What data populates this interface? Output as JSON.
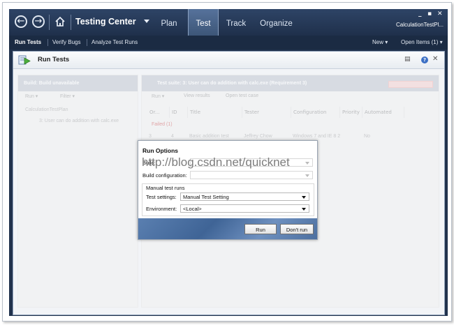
{
  "app": {
    "title": "Testing Center",
    "back_icon": "back-arrow-icon",
    "forward_icon": "forward-arrow-icon",
    "home_icon": "home-icon",
    "tabs": [
      {
        "label": "Plan"
      },
      {
        "label": "Test",
        "active": true
      },
      {
        "label": "Track"
      },
      {
        "label": "Organize"
      }
    ],
    "window_controls": {
      "minimize": "_",
      "restore": "▪",
      "close": "✕"
    },
    "context_name": "CalculationTestPl..."
  },
  "subnav": {
    "items": [
      "Run Tests",
      "Verify Bugs",
      "Analyze Test Runs"
    ],
    "active": "Run Tests",
    "new_label": "New ▾",
    "open_items_label": "Open Items (1) ▾"
  },
  "panel": {
    "title": "Run Tests",
    "build_header": "Build: Build unavailable",
    "left_toolbar": [
      "Run ▾",
      "Filter ▾"
    ],
    "tree_root": "CalculationTestPlan",
    "tree_child": "3: User can do addition with calc.exe",
    "suite_header": "Test suite:  3: User can do addition with calc.exe  (Requirement 3)",
    "right_toolbar": [
      "Run ▾",
      "View results",
      "Open test case"
    ],
    "columns": [
      "Or...",
      "ID",
      "Title",
      "Tester",
      "Configuration",
      "Priority",
      "Automated"
    ],
    "group_label": "Failed (1)",
    "row": {
      "order": "3",
      "id": "4",
      "title": "Basic addition test",
      "tester": "Jeffrey Chow",
      "configuration": "Windows 7 and IE 8 2",
      "priority": "",
      "automated": "No"
    }
  },
  "dialog": {
    "title": "Run Options",
    "build_label": "Build:",
    "build_value": "",
    "build_config_label": "Build configuration:",
    "build_config_value": "",
    "manual_group_label": "Manual test runs",
    "test_settings_label": "Test settings:",
    "test_settings_value": "Manual Test Setting",
    "environment_label": "Environment:",
    "environment_value": "<Local>",
    "run_button": "Run",
    "dont_run_button": "Don't run"
  },
  "watermark": "http://blog.csdn.net/quicknet",
  "colors": {
    "titlebar": "#21324d",
    "active_tab": "#56729b",
    "dialog_footer": "#4c6f9f"
  }
}
